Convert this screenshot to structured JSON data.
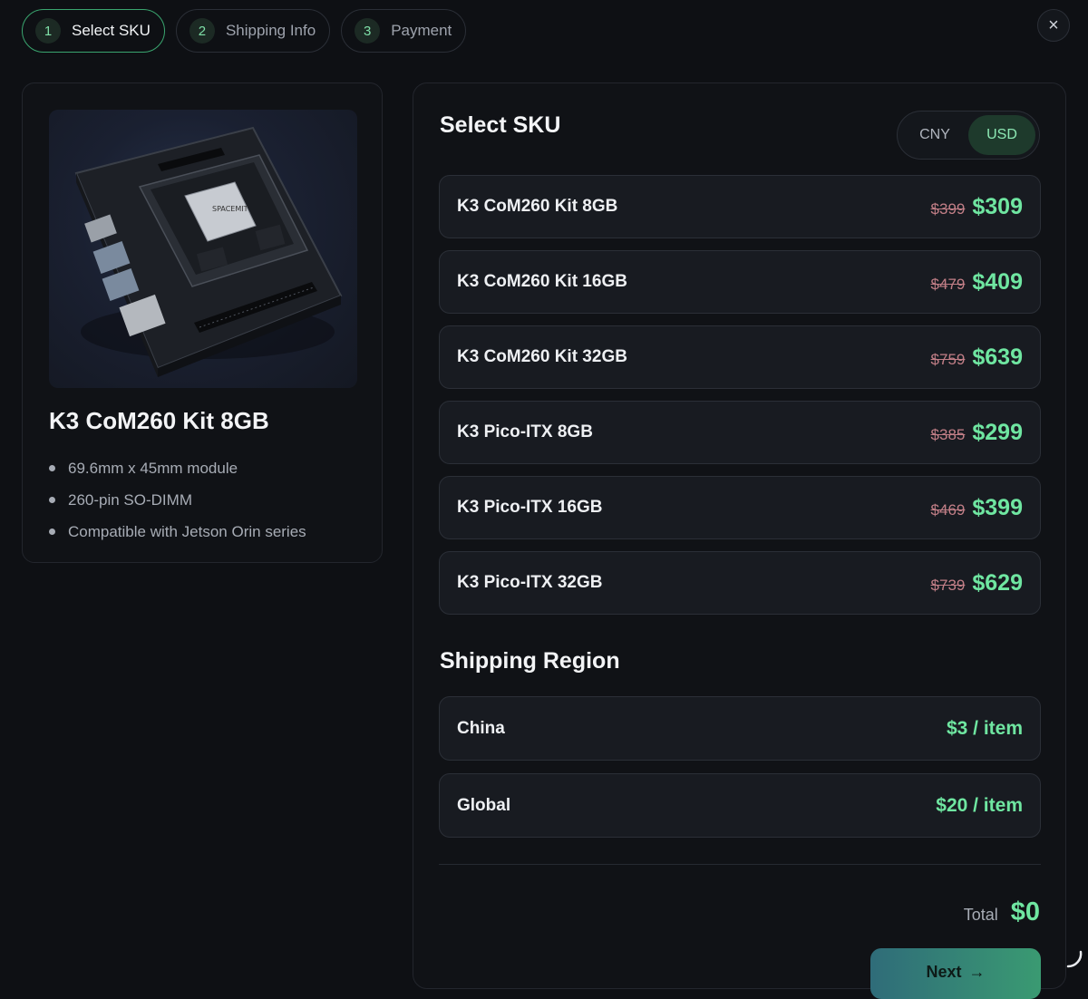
{
  "stepper": {
    "steps": [
      {
        "num": "1",
        "label": "Select SKU",
        "active": true
      },
      {
        "num": "2",
        "label": "Shipping Info",
        "active": false
      },
      {
        "num": "3",
        "label": "Payment",
        "active": false
      }
    ]
  },
  "close_icon": "×",
  "product": {
    "title": "K3 CoM260 Kit 8GB",
    "features": [
      "69.6mm x 45mm module",
      "260-pin SO-DIMM",
      "Compatible with Jetson Orin series"
    ],
    "image_icon": "circuit-board-image"
  },
  "sku_section": {
    "title": "Select SKU",
    "currency": {
      "options": [
        "CNY",
        "USD"
      ],
      "selected": "USD"
    },
    "items": [
      {
        "name": "K3 CoM260 Kit 8GB",
        "old_price": "$399",
        "price": "$309"
      },
      {
        "name": "K3 CoM260 Kit 16GB",
        "old_price": "$479",
        "price": "$409"
      },
      {
        "name": "K3 CoM260 Kit 32GB",
        "old_price": "$759",
        "price": "$639"
      },
      {
        "name": "K3 Pico-ITX 8GB",
        "old_price": "$385",
        "price": "$299"
      },
      {
        "name": "K3 Pico-ITX 16GB",
        "old_price": "$469",
        "price": "$399"
      },
      {
        "name": "K3 Pico-ITX 32GB",
        "old_price": "$739",
        "price": "$629"
      }
    ]
  },
  "shipping": {
    "title": "Shipping Region",
    "regions": [
      {
        "name": "China",
        "price": "$3 / item"
      },
      {
        "name": "Global",
        "price": "$20 / item"
      }
    ]
  },
  "summary": {
    "total_label": "Total",
    "total_value": "$0",
    "next_label": "Next",
    "next_arrow": "→"
  },
  "colors": {
    "accent": "#6fe6a1",
    "background": "#0e1014",
    "strike": "#c27f87"
  }
}
